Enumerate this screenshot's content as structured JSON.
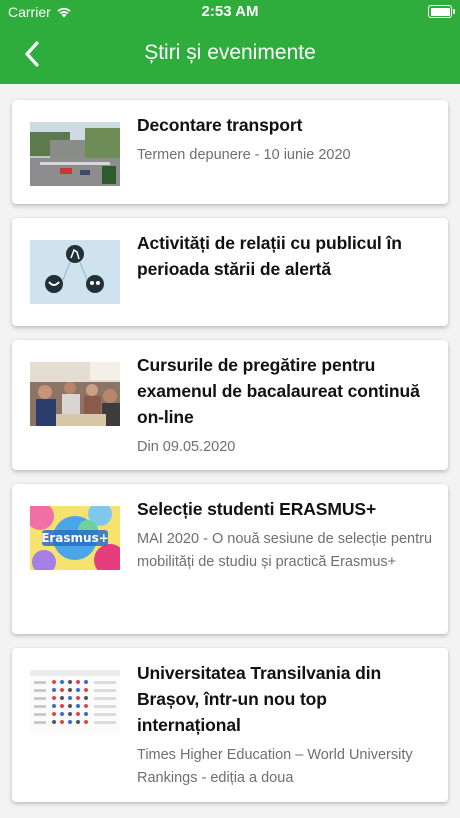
{
  "status_bar": {
    "carrier": "Carrier",
    "time": "2:53 AM"
  },
  "nav": {
    "title": "Știri și evenimente",
    "back_icon": "chevron-left-icon",
    "bar_color": "#2eac3c"
  },
  "news": [
    {
      "title": "Decontare transport",
      "subtitle": "Termen depunere - 10 iunie 2020",
      "image": "street-photo"
    },
    {
      "title": "Activități de relații cu publicul în perioada stării de alertă",
      "subtitle": "",
      "image": "covid-icons-illustration"
    },
    {
      "title": "Cursurile de pregătire pentru examenul de bacalaureat continuă on-line",
      "subtitle": "Din 09.05.2020",
      "image": "classroom-photo"
    },
    {
      "title": "Selecție studenti ERASMUS+",
      "subtitle": "MAI 2020 - O nouă sesiune de selecție pentru mobilități de studiu și practică Erasmus+",
      "image": "erasmus-logo-banner"
    },
    {
      "title": "Universitatea Transilvania din Brașov, într-un nou top internațional",
      "subtitle": "Times Higher Education – World University Rankings - ediția a doua",
      "image": "rankings-table-screenshot"
    }
  ]
}
